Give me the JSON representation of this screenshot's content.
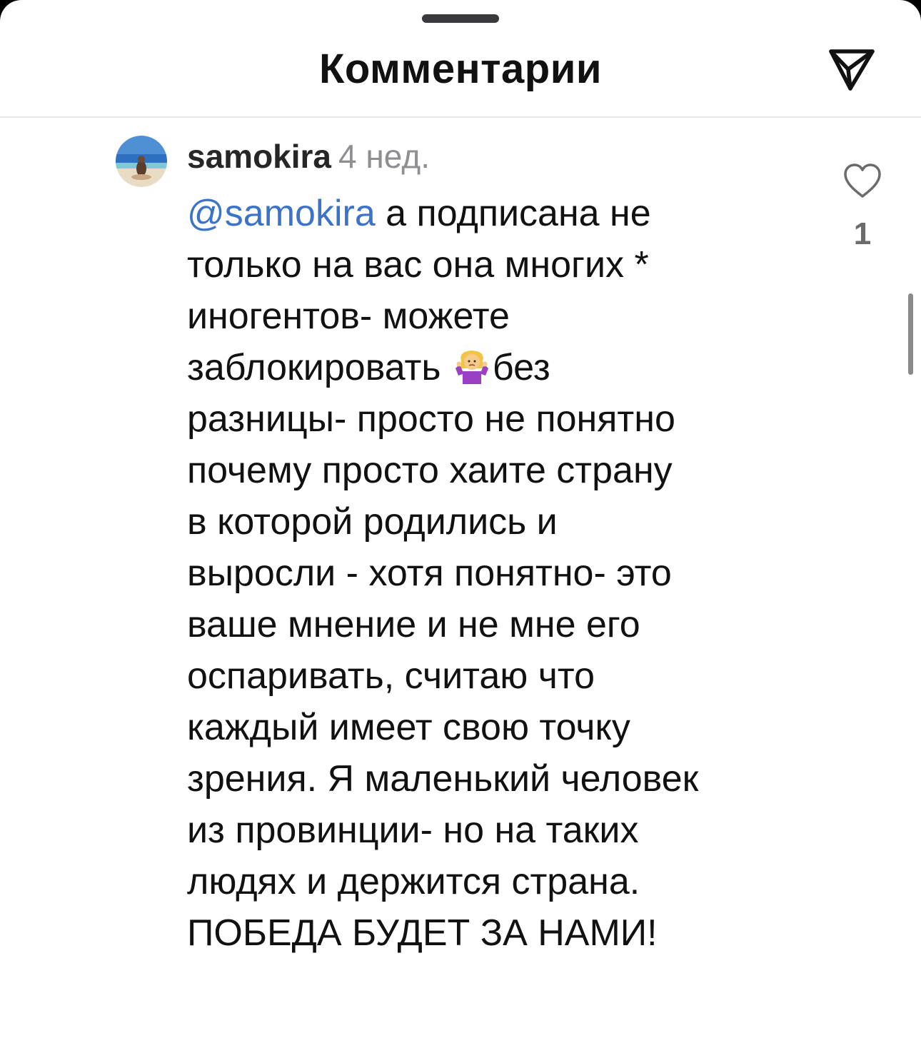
{
  "header": {
    "title": "Комментарии",
    "share_icon": "paper-plane-icon"
  },
  "comment": {
    "username": "samokira",
    "time_ago": "4 нед.",
    "mention": "@samokira",
    "text_before_emoji": " а подписана не\nтолько на вас она многих *\nиногентов- можете\nзаблокировать ",
    "emoji": "woman-shrugging-emoji",
    "text_after_emoji": "без\nразницы- просто не понятно\nпочему просто хаите страну\nв которой родились и\nвыросли - хотя понятно- это\nваше мнение и не мне его\nоспаривать, считаю что\nкаждый имеет свою точку\nзрения. Я маленький человек\nиз провинции- но на таких\nлюдях и держится страна.\nПОБЕДА БУДЕТ ЗА НАМИ!",
    "like_icon": "heart-outline-icon",
    "like_count": "1"
  },
  "colors": {
    "mention": "#3b73c9",
    "text": "#111111",
    "muted": "#8e8e93"
  }
}
